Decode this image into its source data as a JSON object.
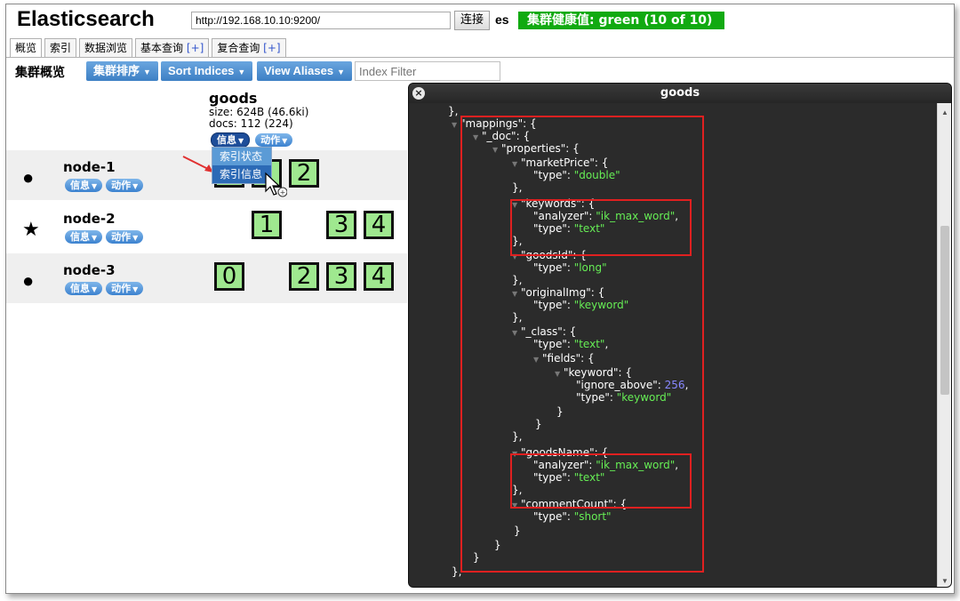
{
  "header": {
    "app_title": "Elasticsearch",
    "url_value": "http://192.168.10.10:9200/",
    "connect_label": "连接",
    "cluster_name": "es",
    "health_label": "集群健康值: green (10 of 10)",
    "health_color": "#11aa11"
  },
  "tabs": [
    {
      "label": "概览"
    },
    {
      "label": "索引"
    },
    {
      "label": "数据浏览"
    },
    {
      "label": "基本查询",
      "plus": "[+]"
    },
    {
      "label": "复合查询",
      "plus": "[+]"
    }
  ],
  "toolbar": {
    "title": "集群概览",
    "sort_cluster": "集群排序",
    "sort_indices": "Sort Indices",
    "view_aliases": "View Aliases",
    "filter_placeholder": "Index Filter"
  },
  "index": {
    "name": "goods",
    "size": "size: 624B (46.6ki)",
    "docs": "docs: 112 (224)",
    "info_label": "信息",
    "action_label": "动作",
    "dropdown": [
      "索引状态",
      "索引信息"
    ]
  },
  "nodes": [
    {
      "name": "node-1",
      "symbol": "●",
      "info": "信息",
      "action": "动作",
      "shards": [
        "0",
        "1",
        "2"
      ]
    },
    {
      "name": "node-2",
      "symbol": "★",
      "info": "信息",
      "action": "动作",
      "shards": [
        "1",
        "3",
        "4"
      ]
    },
    {
      "name": "node-3",
      "symbol": "●",
      "info": "信息",
      "action": "动作",
      "shards": [
        "0",
        "2",
        "3",
        "4"
      ]
    }
  ],
  "dialog": {
    "title": "goods",
    "close": "×",
    "lines": [
      "},",
      "\"mappings\": {",
      "\"_doc\": {",
      "\"properties\": {",
      "\"marketPrice\": {",
      "\"type\": ",
      "\"double\"",
      "},",
      "\"keywords\": {",
      "\"analyzer\": ",
      "\"ik_max_word\"",
      "\"type\": ",
      "\"text\"",
      "},",
      "\"goodsId\": {",
      "\"long\"",
      "\"originalImg\": {",
      "\"keyword\"",
      "\"_class\": {",
      "\"fields\": {",
      "\"keyword\": {",
      "\"ignore_above\": ",
      "256",
      "}",
      "\"goodsName\": {",
      "\"commentCount\": {",
      "\"short\""
    ]
  }
}
